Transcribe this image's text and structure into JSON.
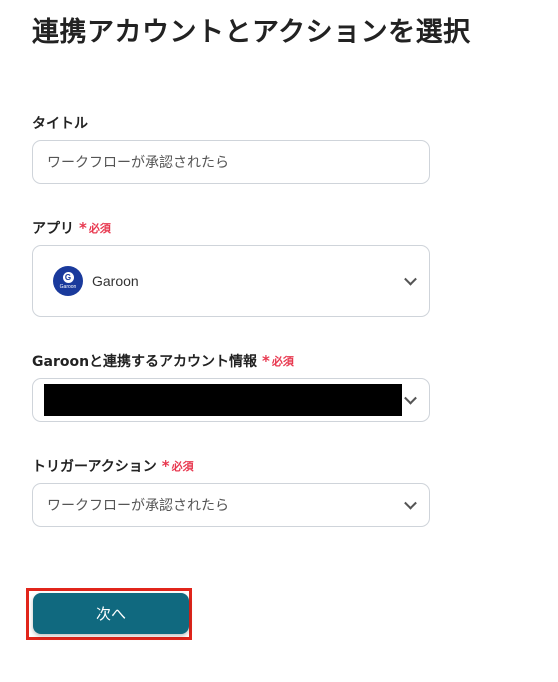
{
  "page": {
    "title": "連携アカウントとアクションを選択"
  },
  "title_field": {
    "label": "タイトル",
    "value": "ワークフローが承認されたら"
  },
  "app_field": {
    "label": "アプリ",
    "required": "必須",
    "selected": "Garoon",
    "logo_text": "Garoon",
    "logo_letter": "G"
  },
  "account_field": {
    "label": "Garoonと連携するアカウント情報",
    "required": "必須"
  },
  "trigger_field": {
    "label": "トリガーアクション",
    "required": "必須",
    "selected": "ワークフローが承認されたら"
  },
  "actions": {
    "next_label": "次へ"
  },
  "colors": {
    "required": "#e8384f",
    "button": "#10697f",
    "highlight": "#e1251b",
    "logo": "#1a3a9c"
  },
  "icons": {
    "dropdown": "chevron-down-icon",
    "app_logo": "garoon-logo-icon"
  }
}
